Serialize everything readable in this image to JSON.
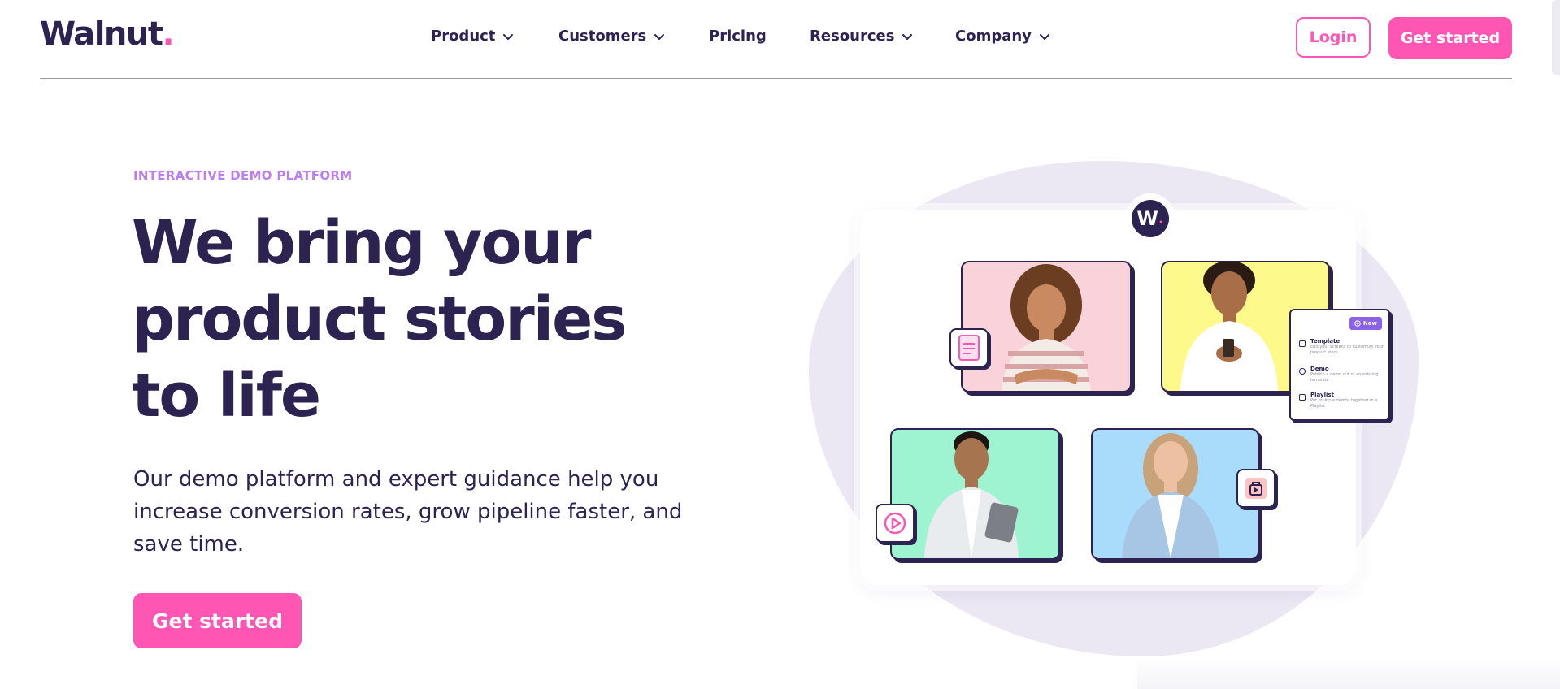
{
  "header": {
    "logo_text": "Walnut",
    "logo_dot": ".",
    "nav": [
      {
        "label": "Product",
        "has_dropdown": true
      },
      {
        "label": "Customers",
        "has_dropdown": true
      },
      {
        "label": "Pricing",
        "has_dropdown": false
      },
      {
        "label": "Resources",
        "has_dropdown": true
      },
      {
        "label": "Company",
        "has_dropdown": true
      }
    ],
    "login_label": "Login",
    "cta_label": "Get started"
  },
  "hero": {
    "eyebrow": "INTERACTIVE DEMO PLATFORM",
    "headline_lines": [
      "We bring your",
      "product stories",
      "to life"
    ],
    "subcopy_lines": [
      "Our demo platform and expert guidance help you",
      "increase conversion rates, grow pipeline faster, and",
      "save time."
    ],
    "cta_label": "Get started"
  },
  "illustration": {
    "badge_letter": "W",
    "badge_dot": ".",
    "panel": {
      "new_label": "New",
      "options": [
        {
          "title": "Template",
          "desc": "Edit your screens to customize your product story",
          "icon": "layers-icon"
        },
        {
          "title": "Demo",
          "desc": "Publish a demo out of an existing template",
          "icon": "play-circle-icon"
        },
        {
          "title": "Playlist",
          "desc": "Put multiple demos together in a Playlist",
          "icon": "playlist-icon"
        }
      ]
    },
    "icons": [
      "document-icon",
      "video-folder-icon",
      "play-icon"
    ]
  },
  "colors": {
    "brand_navy": "#2c2351",
    "brand_pink": "#ff56b4",
    "eyebrow_purple": "#b97ff3",
    "blob": "#ebe7f3",
    "photo_pink": "#f9d3d9",
    "photo_yellow": "#fdfa8b",
    "photo_mint": "#9ef3d1",
    "photo_blue": "#a9dcfb"
  }
}
